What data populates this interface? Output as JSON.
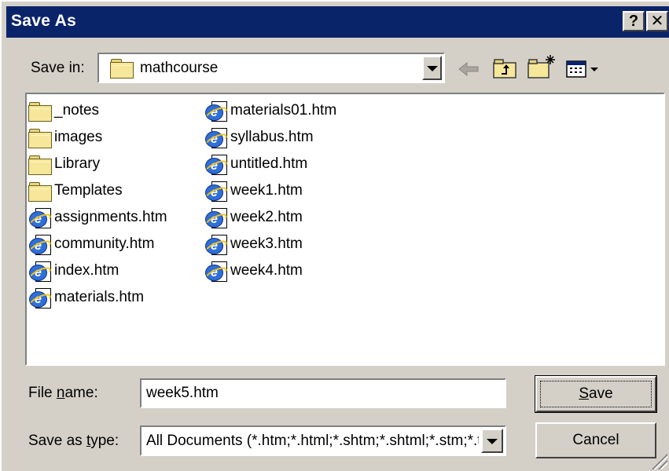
{
  "window": {
    "title": "Save As"
  },
  "caption_buttons": {
    "help": "?",
    "close": "✕"
  },
  "save_in": {
    "label": "Save in:",
    "value": "mathcourse"
  },
  "toolbar": {
    "icons": [
      "back-arrow-icon",
      "up-folder-icon",
      "new-folder-icon",
      "view-menu-icon"
    ]
  },
  "files": {
    "col1": [
      {
        "name": "_notes",
        "type": "folder"
      },
      {
        "name": "images",
        "type": "folder"
      },
      {
        "name": "Library",
        "type": "folder"
      },
      {
        "name": "Templates",
        "type": "folder"
      },
      {
        "name": "assignments.htm",
        "type": "htm"
      },
      {
        "name": "community.htm",
        "type": "htm"
      },
      {
        "name": "index.htm",
        "type": "htm"
      },
      {
        "name": "materials.htm",
        "type": "htm"
      }
    ],
    "col2": [
      {
        "name": "materials01.htm",
        "type": "htm"
      },
      {
        "name": "syllabus.htm",
        "type": "htm"
      },
      {
        "name": "untitled.htm",
        "type": "htm"
      },
      {
        "name": "week1.htm",
        "type": "htm"
      },
      {
        "name": "week2.htm",
        "type": "htm"
      },
      {
        "name": "week3.htm",
        "type": "htm"
      },
      {
        "name": "week4.htm",
        "type": "htm"
      }
    ]
  },
  "filename": {
    "label_pre": "File ",
    "label_key": "n",
    "label_post": "ame:",
    "value": "week5.htm"
  },
  "filetype": {
    "label_pre": "Save as ",
    "label_key": "t",
    "label_post": "ype:",
    "value": "All Documents (*.htm;*.html;*.shtm;*.shtml;*.stm;*.tpl;*.lasso;*.xml)"
  },
  "buttons": {
    "save": {
      "key": "S",
      "rest": "ave"
    },
    "cancel": "Cancel"
  }
}
